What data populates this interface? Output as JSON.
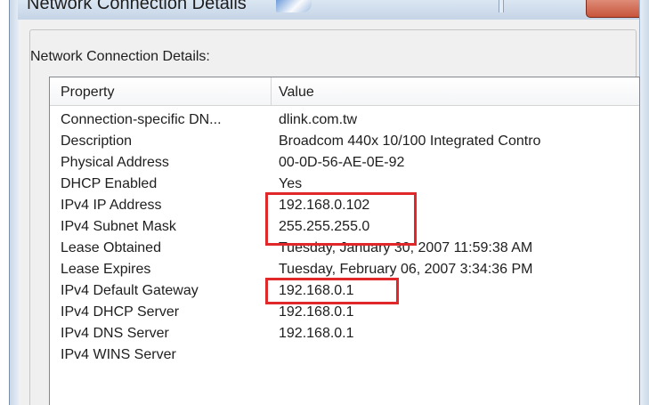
{
  "window": {
    "title": "Network Connection Details"
  },
  "group": {
    "label": "Network Connection Details:"
  },
  "columns": {
    "property": "Property",
    "value": "Value"
  },
  "rows": [
    {
      "property": "Connection-specific DN...",
      "value": "dlink.com.tw"
    },
    {
      "property": "Description",
      "value": "Broadcom 440x 10/100 Integrated Contro"
    },
    {
      "property": "Physical Address",
      "value": "00-0D-56-AE-0E-92"
    },
    {
      "property": "DHCP Enabled",
      "value": "Yes"
    },
    {
      "property": "IPv4 IP Address",
      "value": "192.168.0.102"
    },
    {
      "property": "IPv4 Subnet Mask",
      "value": "255.255.255.0"
    },
    {
      "property": "Lease Obtained",
      "value": "Tuesday, January 30, 2007 11:59:38 AM"
    },
    {
      "property": "Lease Expires",
      "value": "Tuesday, February 06, 2007 3:34:36 PM"
    },
    {
      "property": "IPv4 Default Gateway",
      "value": "192.168.0.1"
    },
    {
      "property": "IPv4 DHCP Server",
      "value": "192.168.0.1"
    },
    {
      "property": "IPv4 DNS Server",
      "value": "192.168.0.1"
    },
    {
      "property": "IPv4 WINS Server",
      "value": ""
    }
  ],
  "colors": {
    "highlight": "#e0282b",
    "close_button": "#c8553c"
  }
}
